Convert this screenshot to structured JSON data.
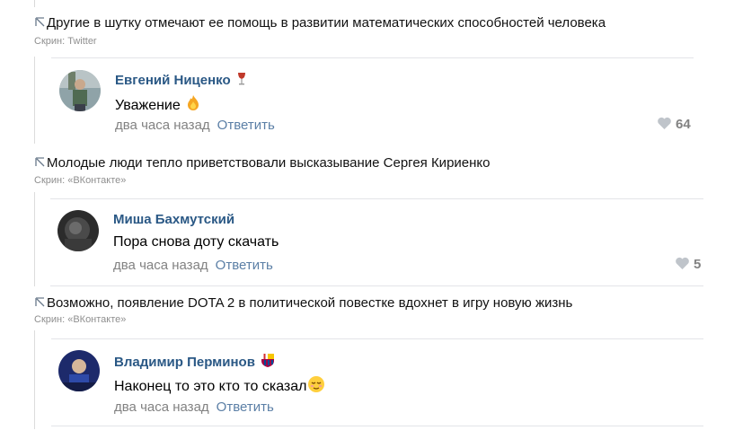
{
  "posts": [
    {
      "caption": "Другие в шутку отмечают ее помощь в развитии математических способностей человека",
      "credit": "Скрин: Twitter",
      "comment": {
        "author": "Евгений Ниценко",
        "badge_icon": "wine-glass-icon",
        "text": "Уважение",
        "text_emoji": "fire-emoji-icon",
        "time": "два часа назад",
        "reply_label": "Ответить",
        "likes": "64"
      }
    },
    {
      "caption": "Молодые люди тепло приветствовали высказывание Сергея Кириенко",
      "credit": "Скрин: «ВКонтакте»",
      "comment": {
        "author": "Миша Бахмутский",
        "text": "Пора снова доту скачать",
        "time": "два часа назад",
        "reply_label": "Ответить",
        "likes": "5"
      }
    },
    {
      "caption": "Возможно, появление DOTA 2 в политической повестке вдохнет в игру новую жизнь",
      "credit": "Скрин: «ВКонтакте»",
      "comment": {
        "author": "Владимир Перминов",
        "badge_icon": "fc-barcelona-crest-icon",
        "text": "Наконец то это кто то сказал",
        "text_emoji": "relieved-face-emoji-icon",
        "time": "два часа назад",
        "reply_label": "Ответить"
      }
    }
  ],
  "colors": {
    "author_link": "#2a5885",
    "reply_link": "#5b7fa6",
    "meta_gray": "#828282",
    "credit_gray": "#8f8f8f",
    "divider": "#e3e4e8"
  }
}
